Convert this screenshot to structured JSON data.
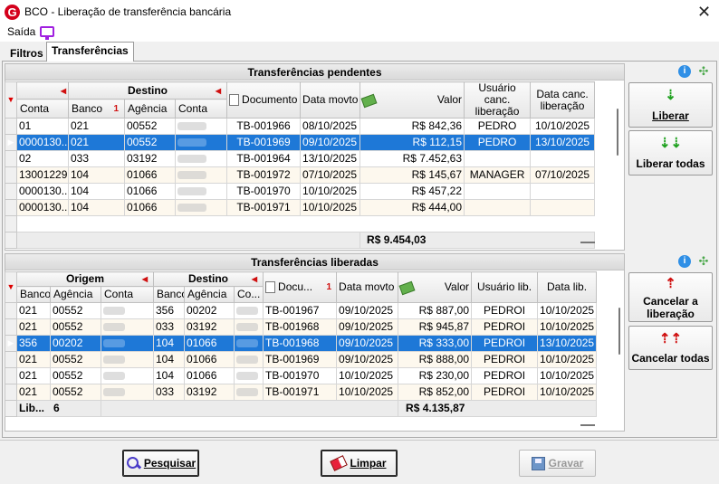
{
  "window": {
    "title": "BCO - Liberação de transferência bancária",
    "close_symbol": "✕"
  },
  "menu": {
    "saida": "Saída"
  },
  "tabs": {
    "filtros": "Filtros",
    "transferencias": "Transferências"
  },
  "pendentes": {
    "title": "Transferências pendentes",
    "group_destino": "Destino",
    "headers": {
      "conta": "Conta",
      "banco": "Banco",
      "agencia": "Agência",
      "conta_dest": "Conta",
      "documento": "Documento",
      "data_movto": "Data movto",
      "valor": "Valor",
      "usuario_canc": "Usuário canc. liberação",
      "data_canc": "Data canc. liberação"
    },
    "rows": [
      {
        "conta": "01",
        "banco": "021",
        "agencia": "00552",
        "documento": "TB-001966",
        "data": "08/10/2025",
        "valor": "R$ 842,36",
        "usuario": "PEDRO",
        "data_canc": "10/10/2025"
      },
      {
        "conta": "0000130...",
        "banco": "021",
        "agencia": "00552",
        "documento": "TB-001969",
        "data": "09/10/2025",
        "valor": "R$ 112,15",
        "usuario": "PEDRO",
        "data_canc": "13/10/2025"
      },
      {
        "conta": "02",
        "banco": "033",
        "agencia": "03192",
        "documento": "TB-001964",
        "data": "13/10/2025",
        "valor": "R$ 7.452,63",
        "usuario": "",
        "data_canc": ""
      },
      {
        "conta": "13001229",
        "banco": "104",
        "agencia": "01066",
        "documento": "TB-001972",
        "data": "07/10/2025",
        "valor": "R$ 145,67",
        "usuario": "MANAGER",
        "data_canc": "07/10/2025"
      },
      {
        "conta": "0000130...",
        "banco": "104",
        "agencia": "01066",
        "documento": "TB-001970",
        "data": "10/10/2025",
        "valor": "R$ 457,22",
        "usuario": "",
        "data_canc": ""
      },
      {
        "conta": "0000130...",
        "banco": "104",
        "agencia": "01066",
        "documento": "TB-001971",
        "data": "10/10/2025",
        "valor": "R$ 444,00",
        "usuario": "",
        "data_canc": ""
      }
    ],
    "total": "R$ 9.454,03",
    "buttons": {
      "liberar": "Liberar",
      "liberar_todas": "Liberar todas"
    }
  },
  "liberadas": {
    "title": "Transferências liberadas",
    "group_origem": "Origem",
    "group_destino": "Destino",
    "headers": {
      "banco": "Banco",
      "agencia": "Agência",
      "conta": "Conta",
      "banco_dest": "Banco",
      "agencia_dest": "Agência",
      "conta_dest": "Co...",
      "documento": "Docu...",
      "data_movto": "Data movto",
      "valor": "Valor",
      "usuario": "Usuário lib.",
      "data_lib": "Data lib."
    },
    "rows": [
      {
        "banco": "021",
        "agencia": "00552",
        "banco_dest": "356",
        "agencia_dest": "00202",
        "documento": "TB-001967",
        "data": "09/10/2025",
        "valor": "R$ 887,00",
        "usuario": "PEDROI",
        "data_lib": "10/10/2025"
      },
      {
        "banco": "021",
        "agencia": "00552",
        "banco_dest": "033",
        "agencia_dest": "03192",
        "documento": "TB-001968",
        "data": "09/10/2025",
        "valor": "R$ 945,87",
        "usuario": "PEDROI",
        "data_lib": "10/10/2025"
      },
      {
        "banco": "356",
        "agencia": "00202",
        "banco_dest": "104",
        "agencia_dest": "01066",
        "documento": "TB-001968",
        "data": "09/10/2025",
        "valor": "R$ 333,00",
        "usuario": "PEDROI",
        "data_lib": "13/10/2025"
      },
      {
        "banco": "021",
        "agencia": "00552",
        "banco_dest": "104",
        "agencia_dest": "01066",
        "documento": "TB-001969",
        "data": "09/10/2025",
        "valor": "R$ 888,00",
        "usuario": "PEDROI",
        "data_lib": "10/10/2025"
      },
      {
        "banco": "021",
        "agencia": "00552",
        "banco_dest": "104",
        "agencia_dest": "01066",
        "documento": "TB-001970",
        "data": "10/10/2025",
        "valor": "R$ 230,00",
        "usuario": "PEDROI",
        "data_lib": "10/10/2025"
      },
      {
        "banco": "021",
        "agencia": "00552",
        "banco_dest": "033",
        "agencia_dest": "03192",
        "documento": "TB-001971",
        "data": "10/10/2025",
        "valor": "R$ 852,00",
        "usuario": "PEDROI",
        "data_lib": "10/10/2025"
      }
    ],
    "footer_label": "Lib...",
    "footer_count": "6",
    "total": "R$ 4.135,87",
    "buttons": {
      "cancelar": "Cancelar a liberação",
      "cancelar_todas": "Cancelar todas"
    }
  },
  "bottom": {
    "pesquisar": "Pesquisar",
    "limpar": "Limpar",
    "gravar": "Gravar"
  },
  "colors": {
    "selected_row": "#1e78d7",
    "alt_row": "#fdf8ee",
    "accent_red": "#d01010"
  },
  "selected": {
    "pendentes_row": 1,
    "liberadas_row": 2
  }
}
